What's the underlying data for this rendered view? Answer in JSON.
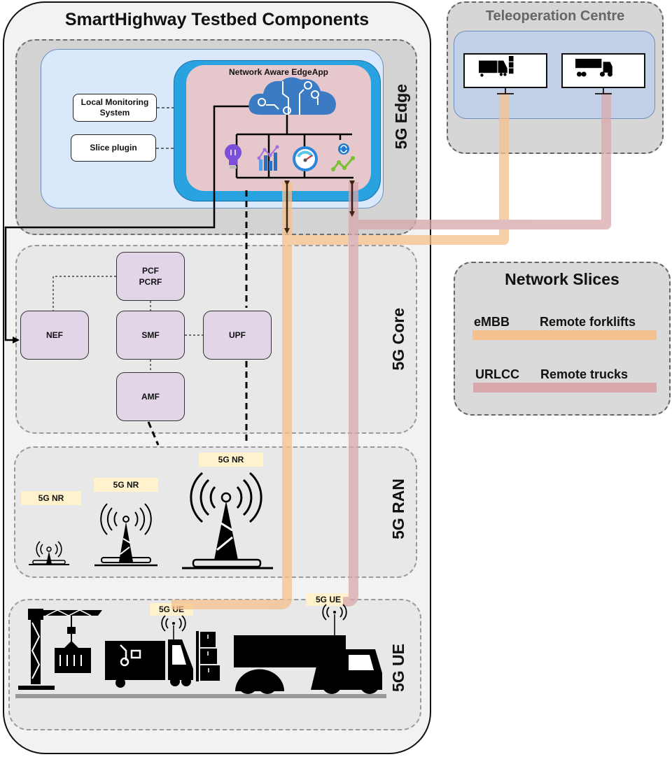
{
  "title": "SmartHighway Testbed Components",
  "zones": {
    "edge": "5G Edge",
    "core": "5G Core",
    "ran": "5G RAN",
    "ue": "5G UE"
  },
  "edge": {
    "app_title": "Network Aware EdgeApp",
    "local_monitoring": "Local Monitoring System",
    "slice_plugin": "Slice plugin",
    "app_icons": [
      "lightbulb-icon",
      "analytics-chart-icon",
      "speedometer-icon",
      "network-sync-icon"
    ]
  },
  "core": {
    "functions": {
      "pcf": [
        "PCF",
        "PCRF"
      ],
      "nef": "NEF",
      "smf": "SMF",
      "upf": "UPF",
      "amf": "AMF"
    }
  },
  "ran": {
    "nodes": [
      "5G NR",
      "5G NR",
      "5G NR"
    ]
  },
  "ue": {
    "labels": [
      "5G UE",
      "5G UE"
    ],
    "assets": [
      "crane-icon",
      "forklift-truck-icon",
      "truck-icon"
    ]
  },
  "teleoperation": {
    "title": "Teleoperation Centre",
    "stations": [
      "forklift-truck-monitor",
      "truck-monitor"
    ]
  },
  "slices": {
    "title": "Network Slices",
    "items": [
      {
        "name": "eMBB",
        "description": "Remote forklifts",
        "color": "#f5c18e"
      },
      {
        "name": "URLCC",
        "description": "Remote trucks",
        "color": "#d8a8ac"
      }
    ]
  },
  "colors": {
    "embb": "#f5c18e",
    "urllc": "#d8a8ac",
    "edge_blue": "#29a3e0",
    "nf_purple": "#e1d5e7",
    "tag_yellow": "#fff2cc"
  }
}
